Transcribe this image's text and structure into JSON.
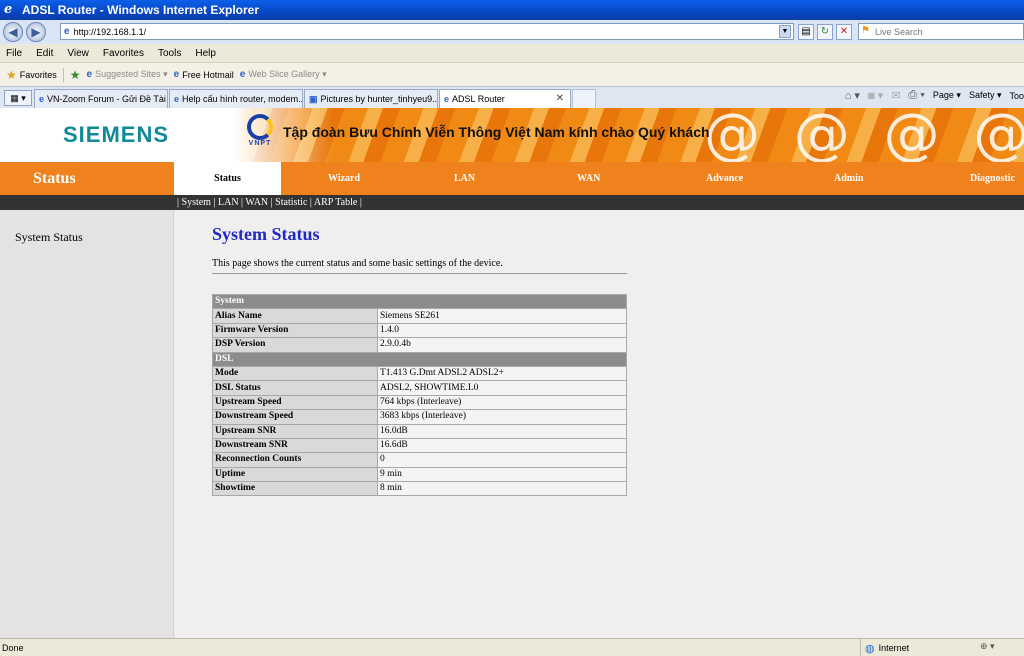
{
  "window": {
    "title": "ADSL Router - Windows Internet Explorer"
  },
  "address": {
    "url": "http://192.168.1.1/",
    "search_placeholder": "Live Search"
  },
  "menu": [
    "File",
    "Edit",
    "View",
    "Favorites",
    "Tools",
    "Help"
  ],
  "favorites_bar": {
    "favorites": "Favorites",
    "suggested": "Suggested Sites ▾",
    "hotmail": "Free Hotmail",
    "webslice": "Web Slice Gallery ▾"
  },
  "tabs": [
    {
      "label": "VN-Zoom Forum - Gửi Đề Tài ..."
    },
    {
      "label": "Help cấu hình router, modem..."
    },
    {
      "label": "Pictures by hunter_tinhyeu9..."
    },
    {
      "label": "ADSL Router"
    }
  ],
  "command_bar": {
    "page": "Page ▾",
    "safety": "Safety ▾",
    "tools": "Too"
  },
  "banner": {
    "brand": "SIEMENS",
    "vnpt": "VNPT",
    "slogan": "Tập đoàn Bưu Chính Viễn Thông Việt Nam kính chào Quý khách",
    "pattern": "@ @ @ @ @"
  },
  "nav": {
    "section_title": "Status",
    "items": [
      "Status",
      "Wizard",
      "LAN",
      "WAN",
      "Advance",
      "Admin",
      "Diagnostic"
    ]
  },
  "subnav": {
    "prefix": "| ",
    "links": [
      "System",
      "LAN",
      "WAN",
      "Statistic",
      "ARP Table"
    ],
    "sep": " | ",
    "suffix": " |"
  },
  "sidebar": {
    "items": [
      "System Status"
    ]
  },
  "main": {
    "title": "System Status",
    "description": "This page shows the current status and some basic settings of the device."
  },
  "status_table": {
    "sections": [
      {
        "header": "System",
        "rows": [
          {
            "label": "Alias Name",
            "value": "Siemens SE261"
          },
          {
            "label": "Firmware Version",
            "value": "1.4.0"
          },
          {
            "label": "DSP Version",
            "value": "2.9.0.4b"
          }
        ]
      },
      {
        "header": "DSL",
        "rows": [
          {
            "label": "Mode",
            "value": "T1.413 G.Dmt ADSL2 ADSL2+"
          },
          {
            "label": "DSL Status",
            "value": "ADSL2, SHOWTIME.L0"
          },
          {
            "label": "Upstream Speed",
            "value": "764 kbps  (Interleave)"
          },
          {
            "label": "Downstream Speed",
            "value": "3683 kbps  (Interleave)"
          },
          {
            "label": "Upstream SNR",
            "value": "16.0dB"
          },
          {
            "label": "Downstream SNR",
            "value": "16.6dB"
          },
          {
            "label": "Reconnection Counts",
            "value": "0"
          },
          {
            "label": "Uptime",
            "value": "9 min"
          },
          {
            "label": "Showtime",
            "value": "8 min"
          }
        ]
      }
    ]
  },
  "statusbar": {
    "left": "Done",
    "zone": "Internet"
  }
}
